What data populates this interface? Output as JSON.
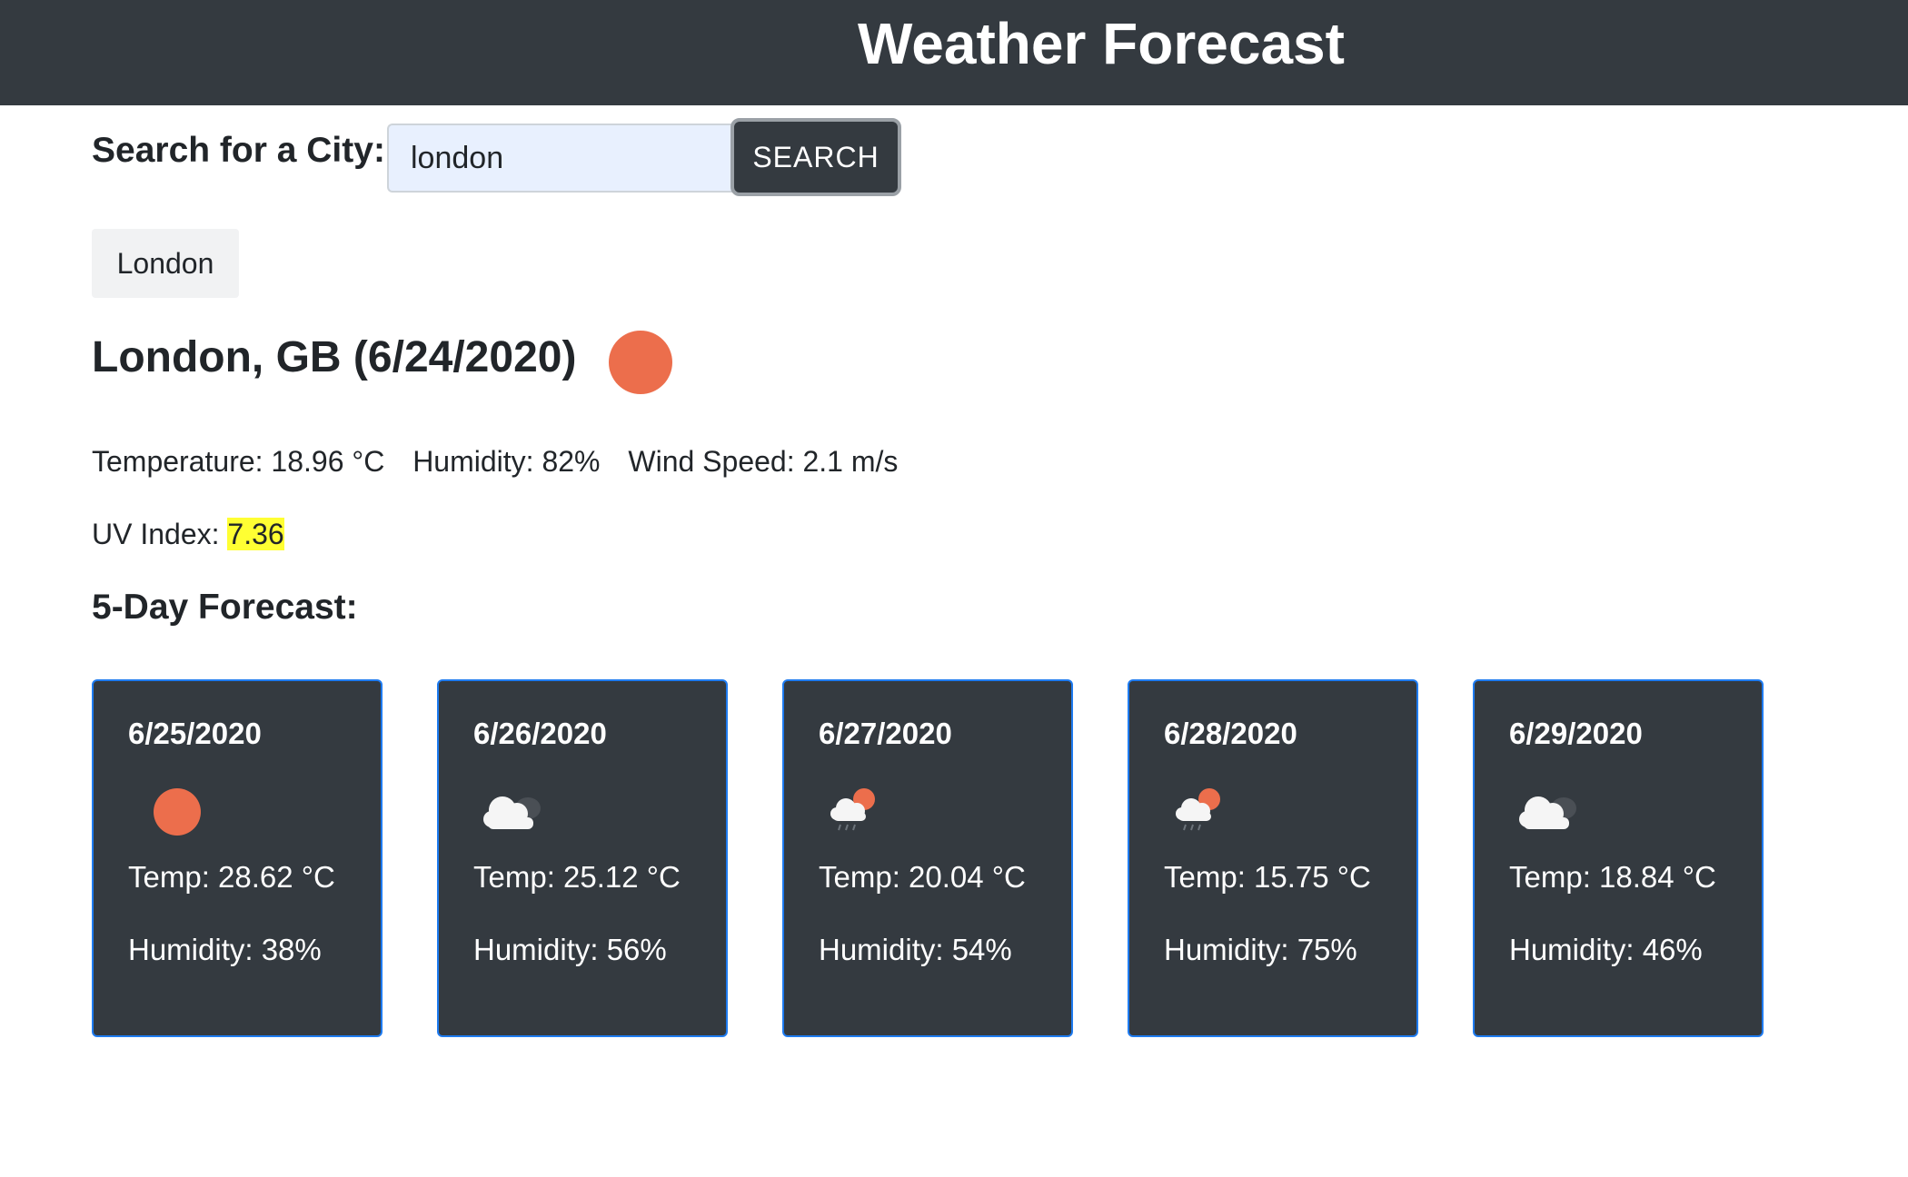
{
  "header": {
    "title": "Weather Forecast"
  },
  "search": {
    "label": "Search for a City:",
    "value": "london",
    "button_label": "SEARCH"
  },
  "history": {
    "items": [
      "London"
    ]
  },
  "current": {
    "heading": "London, GB (6/24/2020)",
    "icon": "sun-icon",
    "temperature": "Temperature: 18.96 °C",
    "humidity": "Humidity: 82%",
    "wind": "Wind Speed: 2.1 m/s",
    "uv_label": "UV Index: ",
    "uv_value": "7.36",
    "uv_color": "#ffff33"
  },
  "forecast": {
    "heading": "5-Day Forecast:",
    "days": [
      {
        "date": "6/25/2020",
        "icon": "sun-icon",
        "temp": "Temp: 28.62 °C",
        "humidity": "Humidity: 38%"
      },
      {
        "date": "6/26/2020",
        "icon": "cloud-icon",
        "temp": "Temp: 25.12 °C",
        "humidity": "Humidity: 56%"
      },
      {
        "date": "6/27/2020",
        "icon": "sun-cloud-rain-icon",
        "temp": "Temp: 20.04 °C",
        "humidity": "Humidity: 54%"
      },
      {
        "date": "6/28/2020",
        "icon": "sun-cloud-rain-icon",
        "temp": "Temp: 15.75 °C",
        "humidity": "Humidity: 75%"
      },
      {
        "date": "6/29/2020",
        "icon": "cloud-icon",
        "temp": "Temp: 18.84 °C",
        "humidity": "Humidity: 46%"
      }
    ]
  },
  "colors": {
    "header_bg": "#343a40",
    "card_bg": "#343a40",
    "card_border": "#1e7bf0",
    "sun": "#ec6e4c"
  }
}
